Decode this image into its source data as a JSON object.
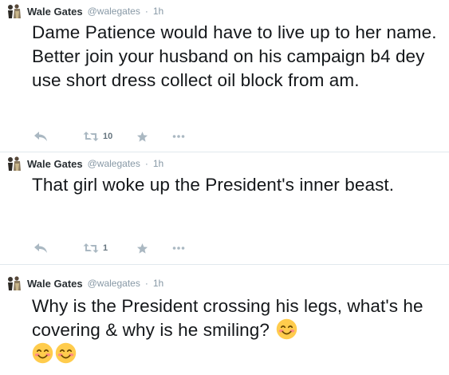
{
  "tweets": [
    {
      "fullname": "Wale Gates",
      "username": "@walegates",
      "separator": "·",
      "time": "1h",
      "text": "Dame Patience would have to live up to her name. Better join your husband on his campaign b4 dey use short dress collect oil block from am.",
      "retweet_count": "10",
      "has_actions": true
    },
    {
      "fullname": "Wale Gates",
      "username": "@walegates",
      "separator": "·",
      "time": "1h",
      "text": "That girl woke up the President's inner beast.",
      "retweet_count": "1",
      "has_actions": true
    },
    {
      "fullname": "Wale Gates",
      "username": "@walegates",
      "separator": "·",
      "time": "1h",
      "text": "Why is the President crossing his legs, what's he covering & why is he smiling?",
      "emojis": [
        "smiling-face-with-smiling-eyes",
        "smiling-face-with-smiling-eyes",
        "smiling-face-with-smiling-eyes"
      ],
      "has_actions": false
    }
  ],
  "icons": {
    "reply": "reply-icon",
    "retweet": "retweet-icon",
    "favorite": "star-icon",
    "more": "more-icon"
  },
  "colors": {
    "name": "#292f33",
    "meta": "#8899a6",
    "text": "#14171a",
    "action": "#aab8c2",
    "divider": "#e1e8ed"
  }
}
